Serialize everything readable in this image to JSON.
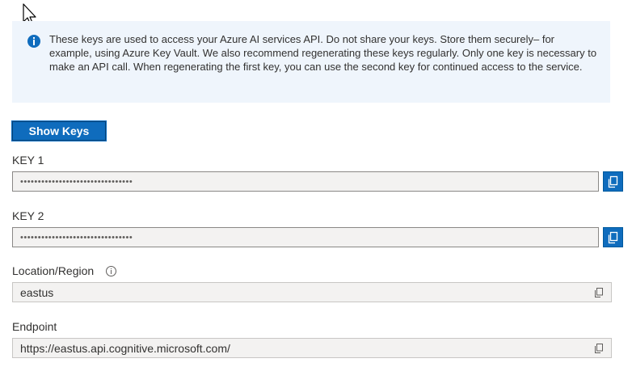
{
  "info": {
    "icon": "info-icon",
    "text": "These keys are used to access your Azure AI services API. Do not share your keys. Store them securely– for example, using Azure Key Vault. We also recommend regenerating these keys regularly. Only one key is necessary to make an API call. When regenerating the first key, you can use the second key for continued access to the service."
  },
  "show_keys_label": "Show Keys",
  "key1": {
    "label": "KEY 1",
    "value": "••••••••••••••••••••••••••••••••",
    "copy_icon": "copy-icon"
  },
  "key2": {
    "label": "KEY 2",
    "value": "••••••••••••••••••••••••••••••••",
    "copy_icon": "copy-icon"
  },
  "location": {
    "label": "Location/Region",
    "value": "eastus",
    "info_icon": "info-icon"
  },
  "endpoint": {
    "label": "Endpoint",
    "value": "https://eastus.api.cognitive.microsoft.com/"
  },
  "colors": {
    "accent": "#0f6cbd",
    "banner_bg": "#eff5fc",
    "field_bg": "#f3f2f1"
  }
}
